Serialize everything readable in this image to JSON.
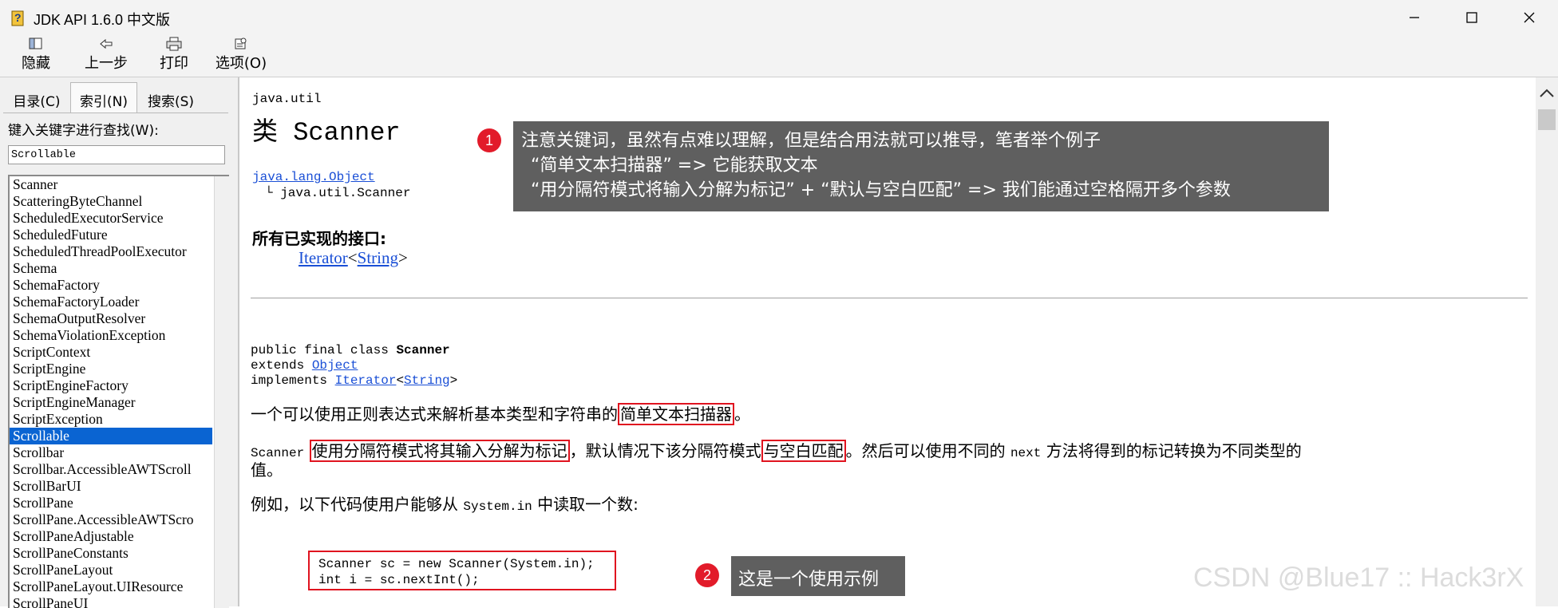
{
  "window": {
    "title": "JDK API 1.6.0 中文版"
  },
  "toolbar": {
    "hide_label": "隐藏",
    "back_label": "上一步",
    "print_label": "打印",
    "options_label": "选项(O)"
  },
  "sidebar": {
    "tabs": [
      "目录(C)",
      "索引(N)",
      "搜索(S)"
    ],
    "active_tab": "索引(N)",
    "keyword_label": "键入关键字进行查找(W):",
    "search_value": "Scrollable",
    "items": [
      "Scanner",
      "ScatteringByteChannel",
      "ScheduledExecutorService",
      "ScheduledFuture",
      "ScheduledThreadPoolExecutor",
      "Schema",
      "SchemaFactory",
      "SchemaFactoryLoader",
      "SchemaOutputResolver",
      "SchemaViolationException",
      "ScriptContext",
      "ScriptEngine",
      "ScriptEngineFactory",
      "ScriptEngineManager",
      "ScriptException",
      "Scrollable",
      "Scrollbar",
      "Scrollbar.AccessibleAWTScroll",
      "ScrollBarUI",
      "ScrollPane",
      "ScrollPane.AccessibleAWTScro",
      "ScrollPaneAdjustable",
      "ScrollPaneConstants",
      "ScrollPaneLayout",
      "ScrollPaneLayout.UIResource",
      "ScrollPaneUI"
    ],
    "selected_item": "Scrollable"
  },
  "doc": {
    "package": "java.util",
    "class_title": "类 Scanner",
    "hierarchy_parent": "java.lang.Object",
    "hierarchy_child": "└ java.util.Scanner",
    "interfaces_heading": "所有已实现的接口:",
    "iface_iterator": "Iterator",
    "iface_string": "String",
    "decl_line1_prefix": "public final class ",
    "decl_line1_name": "Scanner",
    "decl_line2_prefix": "extends ",
    "decl_line2_link": "Object",
    "decl_line3_prefix": "implements ",
    "decl_line3_link1": "Iterator",
    "decl_line3_link2": "String",
    "para1_text": "一个可以使用正则表达式来解析基本类型和字符串的",
    "para1_highlight": "简单文本扫描器",
    "para1_end": "。",
    "para2_code1": "Scanner",
    "para2_hl1": "使用分隔符模式将其输入分解为标记",
    "para2_mid": "，默认情况下该分隔符模式",
    "para2_hl2": "与空白匹配",
    "para2_after": "。然后可以使用不同的",
    "para2_code2": "next",
    "para2_end": "方法将得到的标记转换为不同类型的",
    "para2_line2": "值。",
    "para3_text": "例如，以下代码使用户能够从",
    "para3_code": "System.in",
    "para3_end": "中读取一个数:",
    "code_line1": "Scanner sc = new Scanner(System.in);",
    "code_line2": "int i = sc.nextInt();"
  },
  "annotations": {
    "note1": {
      "badge": "1",
      "line1": "注意关键词，虽然有点难以理解，但是结合用法就可以推导，笔者举个例子",
      "line2": "“简单文本扫描器” => 它能获取文本",
      "line3": "“用分隔符模式将输入分解为标记” + “默认与空白匹配” => 我们能通过空格隔开多个参数"
    },
    "note2": {
      "badge": "2",
      "text": "这是一个使用示例"
    }
  },
  "watermark": "CSDN @Blue17 :: Hack3rX",
  "colors": {
    "link": "#1a4fd6",
    "highlight_border": "#e0131f",
    "selection": "#0a64d2",
    "callout_bg": "#5f5f5f",
    "badge": "#e21b2a"
  }
}
